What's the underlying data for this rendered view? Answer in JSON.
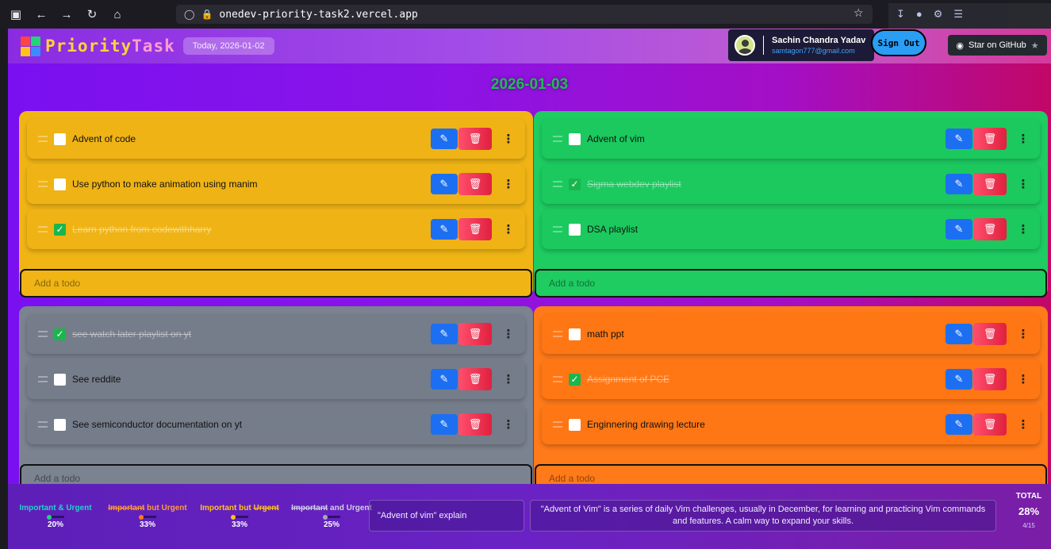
{
  "browser": {
    "url": "onedev-priority-task2.vercel.app"
  },
  "header": {
    "brand_a": "Priority",
    "brand_b": "Task",
    "today": "Today, 2026-01-02",
    "user_name": "Sachin Chandra Yadav",
    "user_email": "samtagon777@gmail.com",
    "signout_label": "Sign Out",
    "github_label": "Star on GitHub"
  },
  "main": {
    "date": "2026-01-03",
    "add_placeholder": "Add a todo"
  },
  "quadrants": [
    {
      "color": "#f0b515",
      "items": [
        {
          "label": "Advent of code",
          "done": false
        },
        {
          "label": "Use python to make animation using manim",
          "done": false
        },
        {
          "label": "Learn python from codewithharry",
          "done": true
        }
      ]
    },
    {
      "color": "#1ecc62",
      "items": [
        {
          "label": "Advent of vim",
          "done": false
        },
        {
          "label": "Sigma webdev playlist",
          "done": true
        },
        {
          "label": "DSA playlist",
          "done": false
        }
      ]
    },
    {
      "color": "#7b8290",
      "items": [
        {
          "label": "see watch later playlist on yt",
          "done": true
        },
        {
          "label": "See reddite",
          "done": false
        },
        {
          "label": "See semiconductor documentation on yt",
          "done": false
        }
      ]
    },
    {
      "color": "#ff7a18",
      "items": [
        {
          "label": "math ppt",
          "done": false
        },
        {
          "label": "Assignment of PCE",
          "done": true
        },
        {
          "label": "Enginnering drawing lecture",
          "done": false
        }
      ]
    }
  ],
  "stats": {
    "items": [
      {
        "name": "Important & Urgent",
        "percent": "20%",
        "color": "#22d37a"
      },
      {
        "name_a": "Important but Urgent",
        "percent": "33%",
        "color": "#ff7a18"
      },
      {
        "name_b": "Important but Urgent",
        "percent": "33%",
        "color": "#ffc21a"
      },
      {
        "name_c": "Important and Urgent",
        "percent": "25%",
        "color": "#a7a7b8"
      }
    ],
    "s1_name": "Important & Urgent",
    "s2_pre": "Important",
    "s2_post": " but Urgent",
    "s3_pre": "Important but ",
    "s3_post": "Urgent",
    "s4_pre": "Important",
    "s4_post": " and Urgent",
    "s1_pc": "20%",
    "s2_pc": "33%",
    "s3_pc": "33%",
    "s4_pc": "25%",
    "question": "\"Advent of vim\" explain",
    "answer": "\"Advent of Vim\" is a series of daily Vim challenges, usually in December, for learning and practicing Vim commands and features. A calm way to expand your skills.",
    "total_label": "TOTAL",
    "total_percent": "28%",
    "total_count": "4/15"
  }
}
